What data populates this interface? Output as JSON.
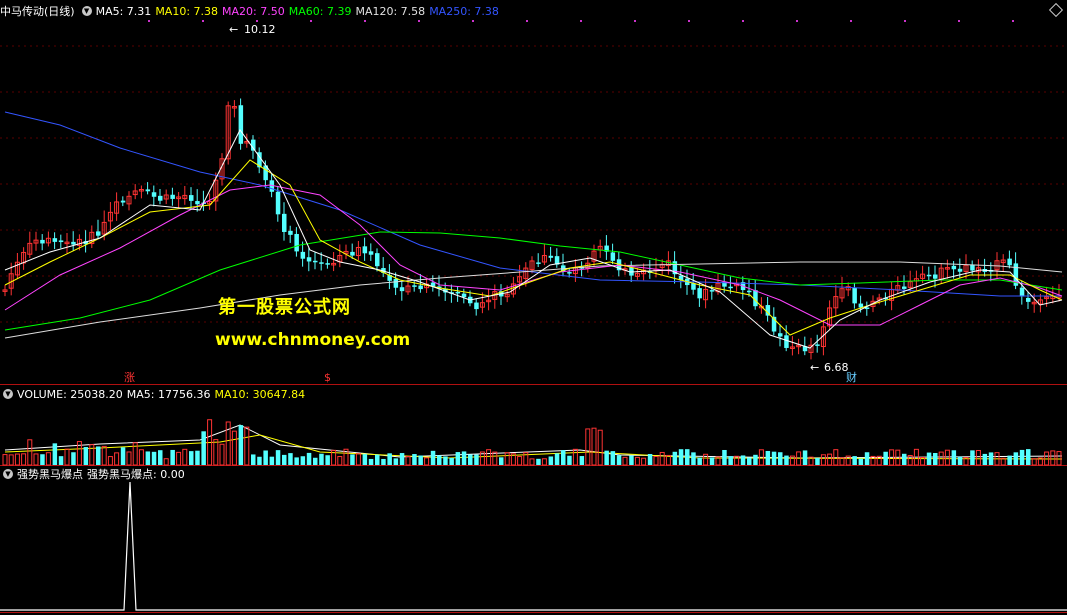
{
  "main_panel": {
    "title": "中马传动(日线)",
    "ma_items": [
      {
        "label": "MA5: 7.31",
        "color": "#ffffff"
      },
      {
        "label": "MA10: 7.38",
        "color": "#ffff00"
      },
      {
        "label": "MA20: 7.50",
        "color": "#ff44ff"
      },
      {
        "label": "MA60: 7.39",
        "color": "#00ff00"
      },
      {
        "label": "MA120: 7.58",
        "color": "#e0e0e0"
      },
      {
        "label": "MA250: 7.38",
        "color": "#3355ff"
      }
    ],
    "high_label": "10.12",
    "low_label": "6.68",
    "markers": [
      {
        "text": "涨",
        "color": "#ff3333"
      },
      {
        "text": "$",
        "color": "#ff3333"
      },
      {
        "text": "财",
        "color": "#66ccff"
      }
    ],
    "watermark_title": "第一股票公式网",
    "watermark_url": "www.chnmoney.com"
  },
  "volume_panel": {
    "label": "VOLUME: 25038.20",
    "ma5": "MA5: 17756.36",
    "ma10": "MA10: 30647.84"
  },
  "indicator_panel": {
    "name": "强势黑马爆点",
    "value_label": "强势黑马爆点: 0.00"
  },
  "colors": {
    "up": "#ff3333",
    "down": "#54ffff",
    "ma250": "#3355ff",
    "ma60": "#00ff00",
    "ma20": "#ff44ff",
    "ma10": "#ffff00",
    "ma5": "#ffffff",
    "ma120": "#dddddd"
  }
}
